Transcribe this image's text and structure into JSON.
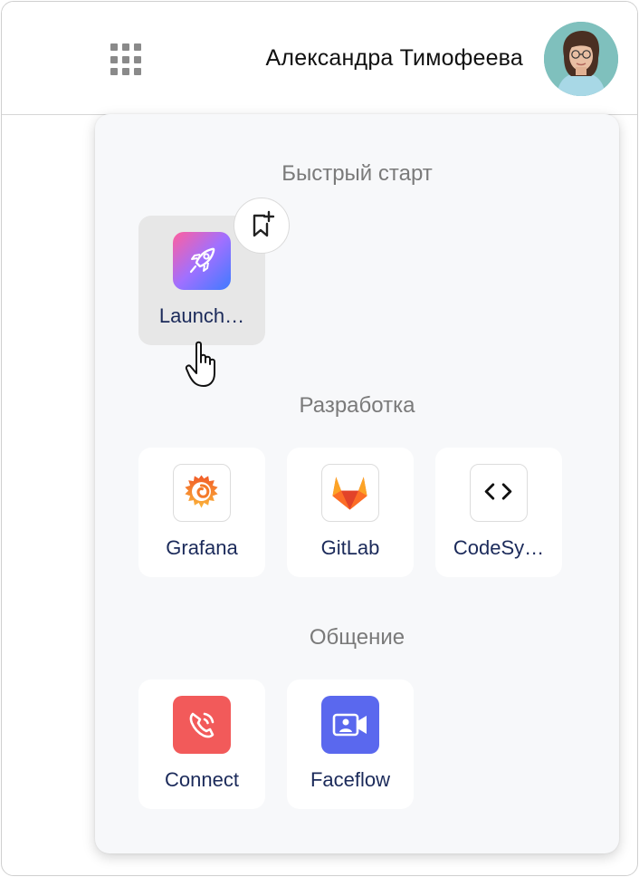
{
  "header": {
    "user_name": "Александра Тимофеева",
    "apps_icon": "apps-grid-icon"
  },
  "sections": [
    {
      "title": "Быстрый старт",
      "apps": [
        {
          "label": "Launch…",
          "icon": "rocket-icon"
        }
      ]
    },
    {
      "title": "Разработка",
      "apps": [
        {
          "label": "Grafana",
          "icon": "grafana-icon"
        },
        {
          "label": "GitLab",
          "icon": "gitlab-icon"
        },
        {
          "label": "CodeSy…",
          "icon": "code-icon"
        }
      ]
    },
    {
      "title": "Общение",
      "apps": [
        {
          "label": "Connect",
          "icon": "phone-call-icon"
        },
        {
          "label": "Faceflow",
          "icon": "video-call-icon"
        }
      ]
    }
  ],
  "colors": {
    "connect": "#f25a5a",
    "faceflow": "#5a68ee",
    "label_text": "#1b2a5a",
    "section_title": "#7a7a7a"
  }
}
